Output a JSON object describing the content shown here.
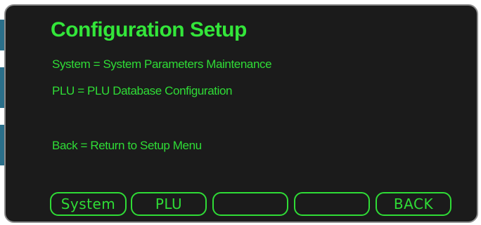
{
  "screen": {
    "title": "Configuration Setup",
    "lines": [
      "System = System Parameters Maintenance",
      "PLU = PLU Database Configuration",
      "Back = Return to Setup Menu"
    ]
  },
  "softkeys": [
    {
      "label": "System"
    },
    {
      "label": "PLU"
    },
    {
      "label": ""
    },
    {
      "label": ""
    },
    {
      "label": "BACK"
    }
  ],
  "colors": {
    "screen_background": "#1b1b1b",
    "text_green": "#2fdc36",
    "title_green": "#33e63a",
    "bezel": "#8e8e8e",
    "edge_accent": "#2a6f8a"
  }
}
